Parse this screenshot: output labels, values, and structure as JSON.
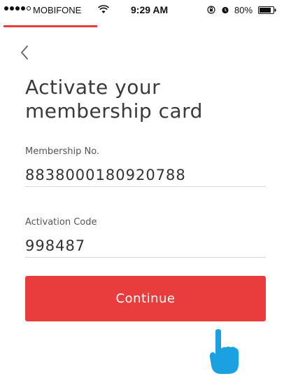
{
  "status_bar": {
    "carrier": "MOBIFONE",
    "time": "9:29 AM",
    "battery_percent": "80%",
    "icons": [
      "signal-dots-icon",
      "wifi-icon",
      "orientation-lock-icon",
      "alarm-icon",
      "battery-icon"
    ]
  },
  "step_progress": {
    "value_fraction": 0.33,
    "color": "#e93c3c"
  },
  "nav": {
    "back_icon": "chevron-left-icon"
  },
  "title": {
    "line1": "Activate your",
    "line2": "membership card"
  },
  "form": {
    "membership": {
      "label": "Membership No.",
      "value": "8838000180920788"
    },
    "activation": {
      "label": "Activation Code",
      "value": "998487"
    }
  },
  "actions": {
    "continue_label": "Continue",
    "accent_color": "#e93c3c"
  },
  "overlay": {
    "pointer_icon": "pointing-hand-icon",
    "pointer_color": "#1ba1e2"
  }
}
